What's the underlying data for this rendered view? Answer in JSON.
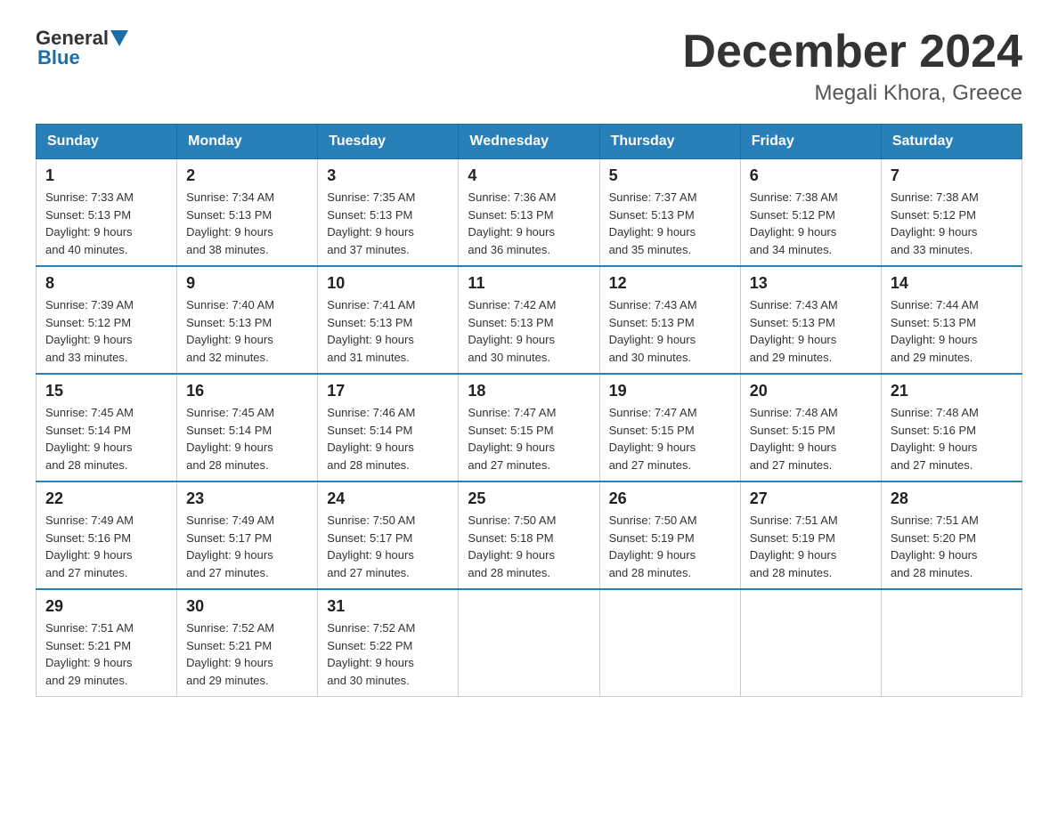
{
  "logo": {
    "general": "General",
    "blue": "Blue"
  },
  "title": "December 2024",
  "subtitle": "Megali Khora, Greece",
  "days_of_week": [
    "Sunday",
    "Monday",
    "Tuesday",
    "Wednesday",
    "Thursday",
    "Friday",
    "Saturday"
  ],
  "weeks": [
    [
      {
        "day": "1",
        "sunrise": "7:33 AM",
        "sunset": "5:13 PM",
        "daylight": "9 hours and 40 minutes."
      },
      {
        "day": "2",
        "sunrise": "7:34 AM",
        "sunset": "5:13 PM",
        "daylight": "9 hours and 38 minutes."
      },
      {
        "day": "3",
        "sunrise": "7:35 AM",
        "sunset": "5:13 PM",
        "daylight": "9 hours and 37 minutes."
      },
      {
        "day": "4",
        "sunrise": "7:36 AM",
        "sunset": "5:13 PM",
        "daylight": "9 hours and 36 minutes."
      },
      {
        "day": "5",
        "sunrise": "7:37 AM",
        "sunset": "5:13 PM",
        "daylight": "9 hours and 35 minutes."
      },
      {
        "day": "6",
        "sunrise": "7:38 AM",
        "sunset": "5:12 PM",
        "daylight": "9 hours and 34 minutes."
      },
      {
        "day": "7",
        "sunrise": "7:38 AM",
        "sunset": "5:12 PM",
        "daylight": "9 hours and 33 minutes."
      }
    ],
    [
      {
        "day": "8",
        "sunrise": "7:39 AM",
        "sunset": "5:12 PM",
        "daylight": "9 hours and 33 minutes."
      },
      {
        "day": "9",
        "sunrise": "7:40 AM",
        "sunset": "5:13 PM",
        "daylight": "9 hours and 32 minutes."
      },
      {
        "day": "10",
        "sunrise": "7:41 AM",
        "sunset": "5:13 PM",
        "daylight": "9 hours and 31 minutes."
      },
      {
        "day": "11",
        "sunrise": "7:42 AM",
        "sunset": "5:13 PM",
        "daylight": "9 hours and 30 minutes."
      },
      {
        "day": "12",
        "sunrise": "7:43 AM",
        "sunset": "5:13 PM",
        "daylight": "9 hours and 30 minutes."
      },
      {
        "day": "13",
        "sunrise": "7:43 AM",
        "sunset": "5:13 PM",
        "daylight": "9 hours and 29 minutes."
      },
      {
        "day": "14",
        "sunrise": "7:44 AM",
        "sunset": "5:13 PM",
        "daylight": "9 hours and 29 minutes."
      }
    ],
    [
      {
        "day": "15",
        "sunrise": "7:45 AM",
        "sunset": "5:14 PM",
        "daylight": "9 hours and 28 minutes."
      },
      {
        "day": "16",
        "sunrise": "7:45 AM",
        "sunset": "5:14 PM",
        "daylight": "9 hours and 28 minutes."
      },
      {
        "day": "17",
        "sunrise": "7:46 AM",
        "sunset": "5:14 PM",
        "daylight": "9 hours and 28 minutes."
      },
      {
        "day": "18",
        "sunrise": "7:47 AM",
        "sunset": "5:15 PM",
        "daylight": "9 hours and 27 minutes."
      },
      {
        "day": "19",
        "sunrise": "7:47 AM",
        "sunset": "5:15 PM",
        "daylight": "9 hours and 27 minutes."
      },
      {
        "day": "20",
        "sunrise": "7:48 AM",
        "sunset": "5:15 PM",
        "daylight": "9 hours and 27 minutes."
      },
      {
        "day": "21",
        "sunrise": "7:48 AM",
        "sunset": "5:16 PM",
        "daylight": "9 hours and 27 minutes."
      }
    ],
    [
      {
        "day": "22",
        "sunrise": "7:49 AM",
        "sunset": "5:16 PM",
        "daylight": "9 hours and 27 minutes."
      },
      {
        "day": "23",
        "sunrise": "7:49 AM",
        "sunset": "5:17 PM",
        "daylight": "9 hours and 27 minutes."
      },
      {
        "day": "24",
        "sunrise": "7:50 AM",
        "sunset": "5:17 PM",
        "daylight": "9 hours and 27 minutes."
      },
      {
        "day": "25",
        "sunrise": "7:50 AM",
        "sunset": "5:18 PM",
        "daylight": "9 hours and 28 minutes."
      },
      {
        "day": "26",
        "sunrise": "7:50 AM",
        "sunset": "5:19 PM",
        "daylight": "9 hours and 28 minutes."
      },
      {
        "day": "27",
        "sunrise": "7:51 AM",
        "sunset": "5:19 PM",
        "daylight": "9 hours and 28 minutes."
      },
      {
        "day": "28",
        "sunrise": "7:51 AM",
        "sunset": "5:20 PM",
        "daylight": "9 hours and 28 minutes."
      }
    ],
    [
      {
        "day": "29",
        "sunrise": "7:51 AM",
        "sunset": "5:21 PM",
        "daylight": "9 hours and 29 minutes."
      },
      {
        "day": "30",
        "sunrise": "7:52 AM",
        "sunset": "5:21 PM",
        "daylight": "9 hours and 29 minutes."
      },
      {
        "day": "31",
        "sunrise": "7:52 AM",
        "sunset": "5:22 PM",
        "daylight": "9 hours and 30 minutes."
      },
      null,
      null,
      null,
      null
    ]
  ],
  "labels": {
    "sunrise": "Sunrise:",
    "sunset": "Sunset:",
    "daylight": "Daylight:"
  }
}
